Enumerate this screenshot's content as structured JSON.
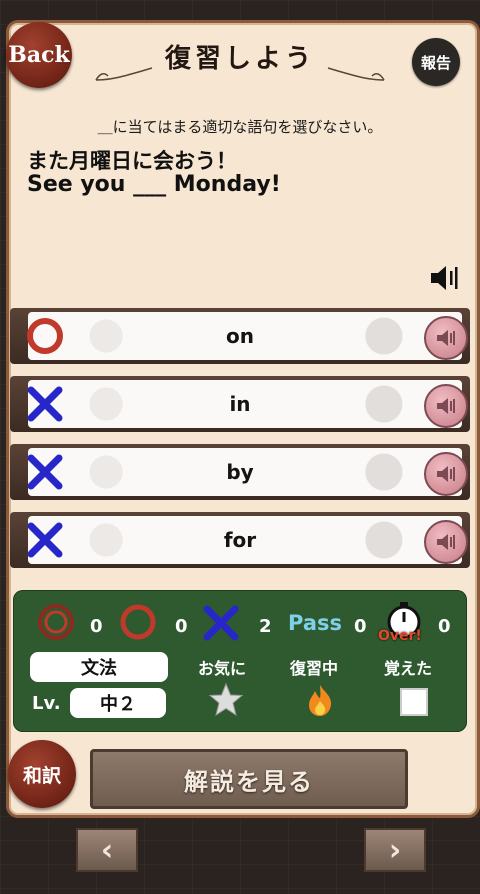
{
  "header": {
    "back_label": "Back",
    "title": "復習しよう",
    "report_label": "報告"
  },
  "question": {
    "instruction": "＿に当てはまる適切な語句を選びなさい。",
    "japanese": "また月曜日に会おう！",
    "english": "See you ___ Monday!"
  },
  "choices": [
    {
      "label": "on",
      "mark": "circle-icon"
    },
    {
      "label": "in",
      "mark": "cross-icon"
    },
    {
      "label": "by",
      "mark": "cross-icon"
    },
    {
      "label": "for",
      "mark": "cross-icon"
    }
  ],
  "stats": {
    "double_circle_count": "0",
    "circle_count": "0",
    "cross_count": "2",
    "pass_label": "Pass",
    "pass_count": "0",
    "over_label": "Over!",
    "over_count": "0",
    "category": "文法",
    "favorite_label": "お気に",
    "review_label": "復習中",
    "learned_label": "覚えた",
    "level_label": "Lv.",
    "level_value": "中２"
  },
  "footer": {
    "translation_label": "和訳",
    "explanation_label": "解説を見る"
  },
  "colors": {
    "accent_red": "#c0392b",
    "cross_blue": "#2727c9",
    "panel_green": "#2f5a30",
    "paper": "#f6e6d2"
  }
}
